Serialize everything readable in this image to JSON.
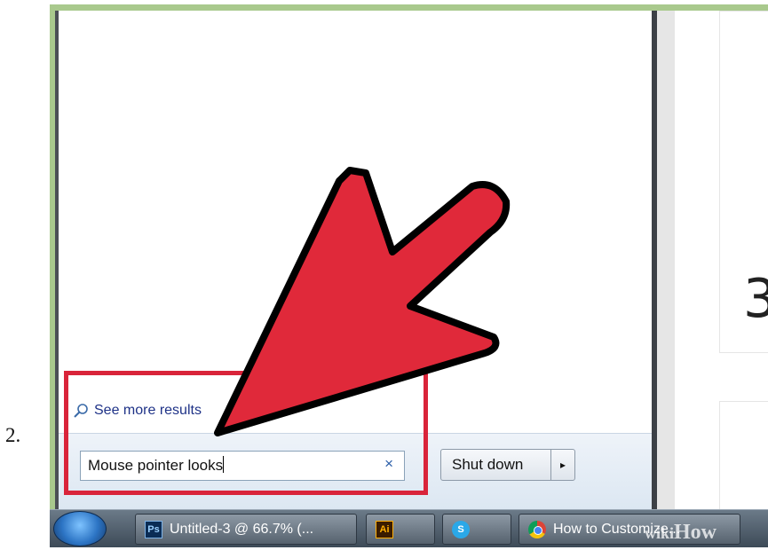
{
  "step": {
    "number": "2."
  },
  "start_menu": {
    "see_more_label": "See more results",
    "search_value": "Mouse pointer looks",
    "clear_glyph": "×",
    "shutdown_label": "Shut down",
    "shutdown_arrow_glyph": "▸"
  },
  "background_page": {
    "partial_number": "3"
  },
  "taskbar": {
    "items": [
      {
        "icon": "ps-icon",
        "icon_text": "Ps",
        "label": "Untitled-3 @ 66.7% (..."
      },
      {
        "icon": "ai-icon",
        "icon_text": "Ai",
        "label": ""
      },
      {
        "icon": "skype-icon",
        "icon_text": "S",
        "label": ""
      },
      {
        "icon": "chrome-icon",
        "icon_text": "",
        "label": "How to Customize..."
      }
    ]
  },
  "watermark": {
    "prefix": "wiki",
    "suffix": "How"
  },
  "colors": {
    "frame": "#a9c98d",
    "highlight": "#d9243a",
    "arrow_fill": "#e0293a",
    "link_blue": "#1e3287"
  }
}
